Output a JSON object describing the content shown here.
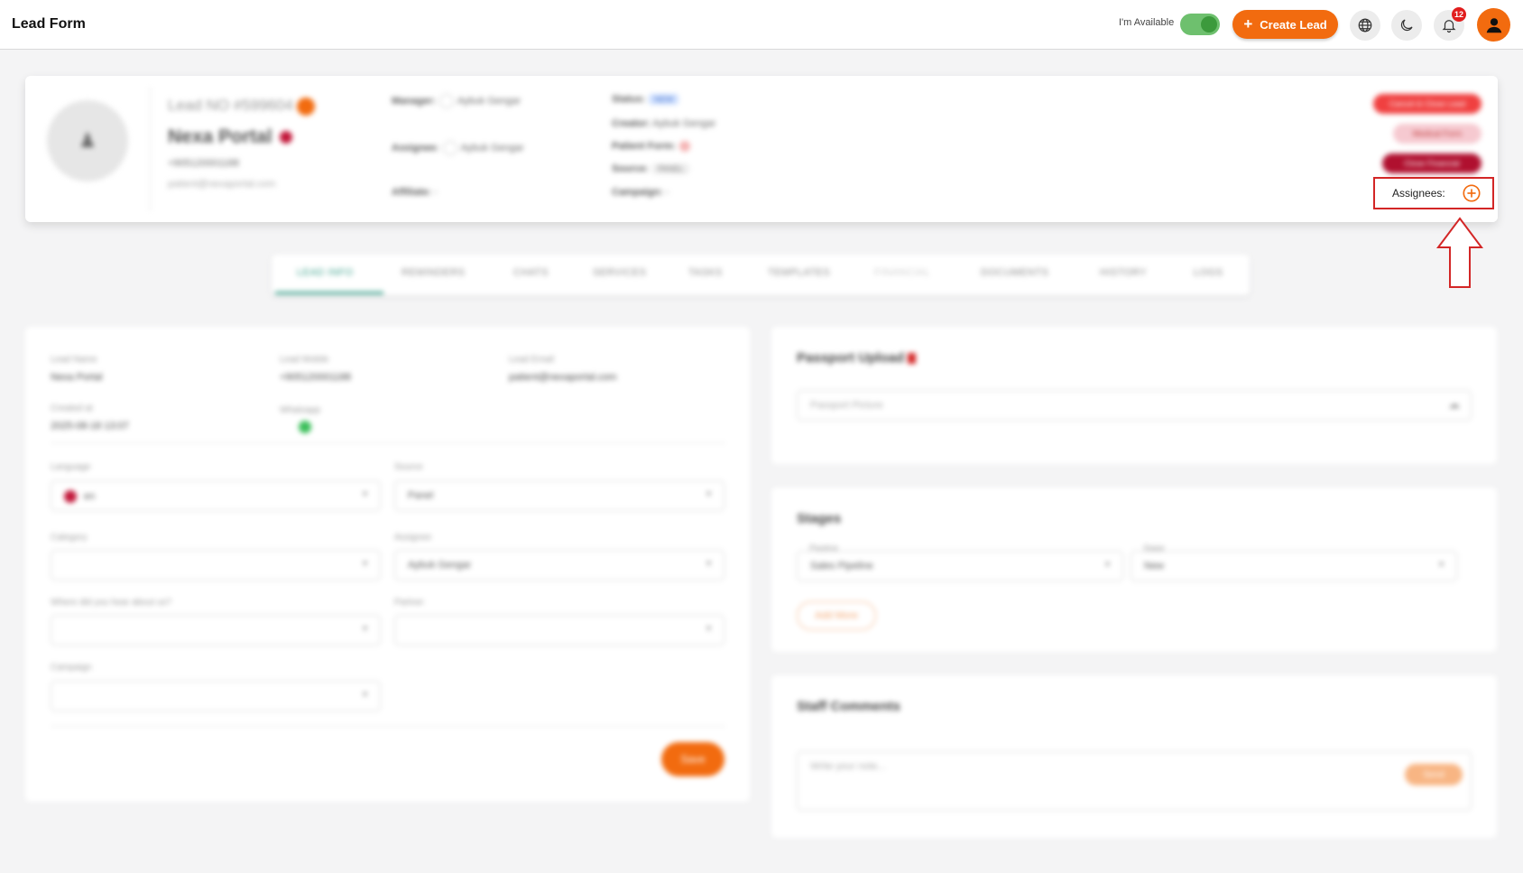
{
  "topbar": {
    "title": "Lead Form",
    "availability_label": "I'm Available",
    "availability_on": true,
    "create_lead_label": "Create Lead",
    "notification_count": "12"
  },
  "lead_header": {
    "lead_no": "Lead NO #599604",
    "name": "Nexa Portal",
    "phone": "+905120001188",
    "email": "patient@nexaportal.com",
    "manager_label": "Manager:",
    "manager_name": "Aybuk Gengar",
    "assignee_label": "Assignee:",
    "assignee_name": "Aybuk Gengar",
    "affiliate_label": "Affiliate:",
    "affiliate_value": "-",
    "status_label": "Status:",
    "status_value": "NEW",
    "creator_label": "Creator:",
    "creator_value": "Aybuk Gengar",
    "patient_form_label": "Patient Form:",
    "source_label": "Source:",
    "source_value": "PANEL",
    "campaign_label": "Campaign:",
    "campaign_value": "-",
    "actions": {
      "cancel_close": "Cancel & Close Lead",
      "medical_form": "Medical Form",
      "close_financial": "Close Financial"
    },
    "assignees_label": "Assignees:"
  },
  "tabs": [
    {
      "label": "LEAD INFO",
      "active": true
    },
    {
      "label": "REMINDERS",
      "active": false
    },
    {
      "label": "CHATS",
      "active": false
    },
    {
      "label": "SERVICES",
      "active": false
    },
    {
      "label": "TASKS",
      "active": false
    },
    {
      "label": "TEMPLATES",
      "active": false
    },
    {
      "label": "FINANCIAL",
      "active": false
    },
    {
      "label": "DOCUMENTS",
      "active": false
    },
    {
      "label": "HISTORY",
      "active": false
    },
    {
      "label": "LOGS",
      "active": false
    }
  ],
  "lead_info": {
    "lead_name_label": "Lead Name",
    "lead_name": "Nexa Portal",
    "lead_mobile_label": "Lead Mobile",
    "lead_mobile": "+905120001188",
    "lead_email_label": "Lead Email",
    "lead_email": "patient@nexaportal.com",
    "created_at_label": "Created at",
    "created_at": "2025-08-18 13:07",
    "whatsapp_label": "Whatsapp",
    "language_label": "Language",
    "language_value": "en",
    "source_label": "Source",
    "source_value": "Panel",
    "category_label": "Category",
    "category_value": "",
    "assignee_label": "Assignee",
    "assignee_value": "Aybuk Gengar",
    "hear_label": "Where did you hear about us?",
    "hear_value": "",
    "partner_label": "Partner",
    "partner_value": "",
    "campaign_label": "Campaign",
    "campaign_value": "",
    "save_label": "Save"
  },
  "passport": {
    "title": "Passport Upload",
    "placeholder": "Passport Picture"
  },
  "stages": {
    "title": "Stages",
    "pipeline_label": "Pipeline",
    "pipeline_value": "Sales Pipeline",
    "stage_label": "Stage",
    "stage_value": "New",
    "add_more": "Add More"
  },
  "comments": {
    "title": "Staff Comments",
    "placeholder": "Write your note...",
    "send_label": "Send"
  },
  "colors": {
    "accent": "#f26b0f",
    "highlight_box": "#d32626",
    "toggle_on": "#3c9a3c"
  }
}
